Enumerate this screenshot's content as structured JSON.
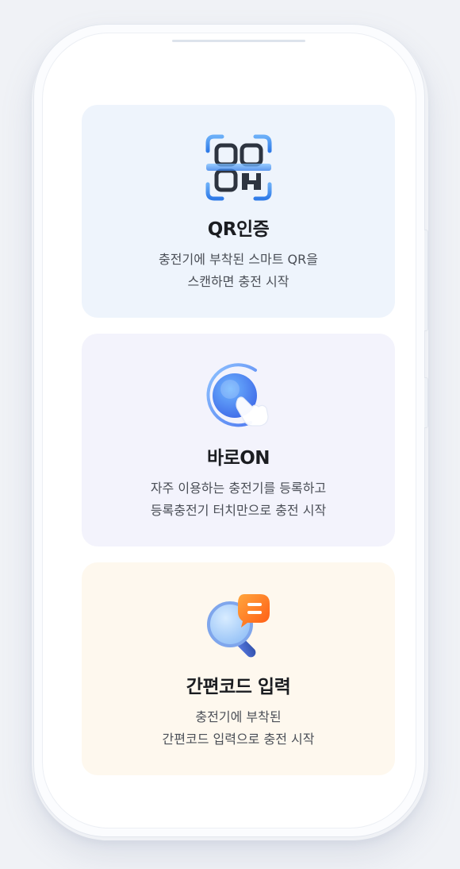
{
  "cards": [
    {
      "title": "QR인증",
      "desc_line1": "충전기에 부착된 스마트 QR을",
      "desc_line2": "스캔하면 충전 시작",
      "icon": "qr-scan-icon",
      "background": "#eef4fc"
    },
    {
      "title": "바로ON",
      "desc_line1": "자주 이용하는 충전기를 등록하고",
      "desc_line2": "등록충전기 터치만으로 충전 시작",
      "icon": "touch-button-icon",
      "background": "#f3f3fc"
    },
    {
      "title": "간편코드 입력",
      "desc_line1": "충전기에 부착된",
      "desc_line2": "간편코드 입력으로 충전 시작",
      "icon": "search-code-icon",
      "background": "#fef8ee"
    }
  ],
  "colors": {
    "accent_blue": "#3f8cf0",
    "accent_orange": "#ff7a1a",
    "page_background": "#f0f2f6"
  }
}
